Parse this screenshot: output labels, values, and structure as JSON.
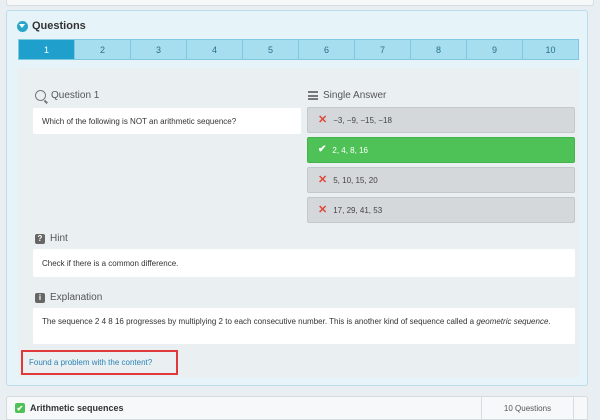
{
  "panel": {
    "title": "Questions",
    "tabs": [
      {
        "label": "1",
        "active": true
      },
      {
        "label": "2"
      },
      {
        "label": "3"
      },
      {
        "label": "4"
      },
      {
        "label": "5"
      },
      {
        "label": "6"
      },
      {
        "label": "7"
      },
      {
        "label": "8"
      },
      {
        "label": "9"
      },
      {
        "label": "10"
      }
    ]
  },
  "question": {
    "heading": "Question 1",
    "text": "Which of the following is NOT an arithmetic sequence?"
  },
  "answers": {
    "heading": "Single Answer",
    "options": [
      {
        "text": "−3, −9, −15, −18",
        "state": "incorrect"
      },
      {
        "text": "2, 4, 8, 16",
        "state": "correct"
      },
      {
        "text": "5, 10, 15, 20",
        "state": "incorrect"
      },
      {
        "text": "17, 29, 41, 53",
        "state": "incorrect"
      }
    ]
  },
  "hint": {
    "heading": "Hint",
    "text": "Check if there is a common difference."
  },
  "explanation": {
    "heading": "Explanation",
    "text": "The sequence 2 4 8 16 progresses by multiplying 2 to each consecutive number. This is another kind of sequence called a ",
    "emphasis": "geometric sequence",
    "tail": "."
  },
  "report_link": "Found a problem with the content?",
  "bottom": {
    "title": "Arithmetic sequences",
    "count": "10 Questions"
  },
  "colors": {
    "accent": "#1fa0cc",
    "correct": "#4fc257",
    "incorrect_mark": "#e0473b",
    "highlight_border": "#e0393b"
  },
  "icons": {
    "panel_toggle": "chevron-down-circle-icon",
    "question": "search-icon",
    "answers": "list-icon",
    "hint": "question-mark-icon",
    "explanation": "info-icon",
    "incorrect": "x-icon",
    "correct": "check-icon"
  }
}
